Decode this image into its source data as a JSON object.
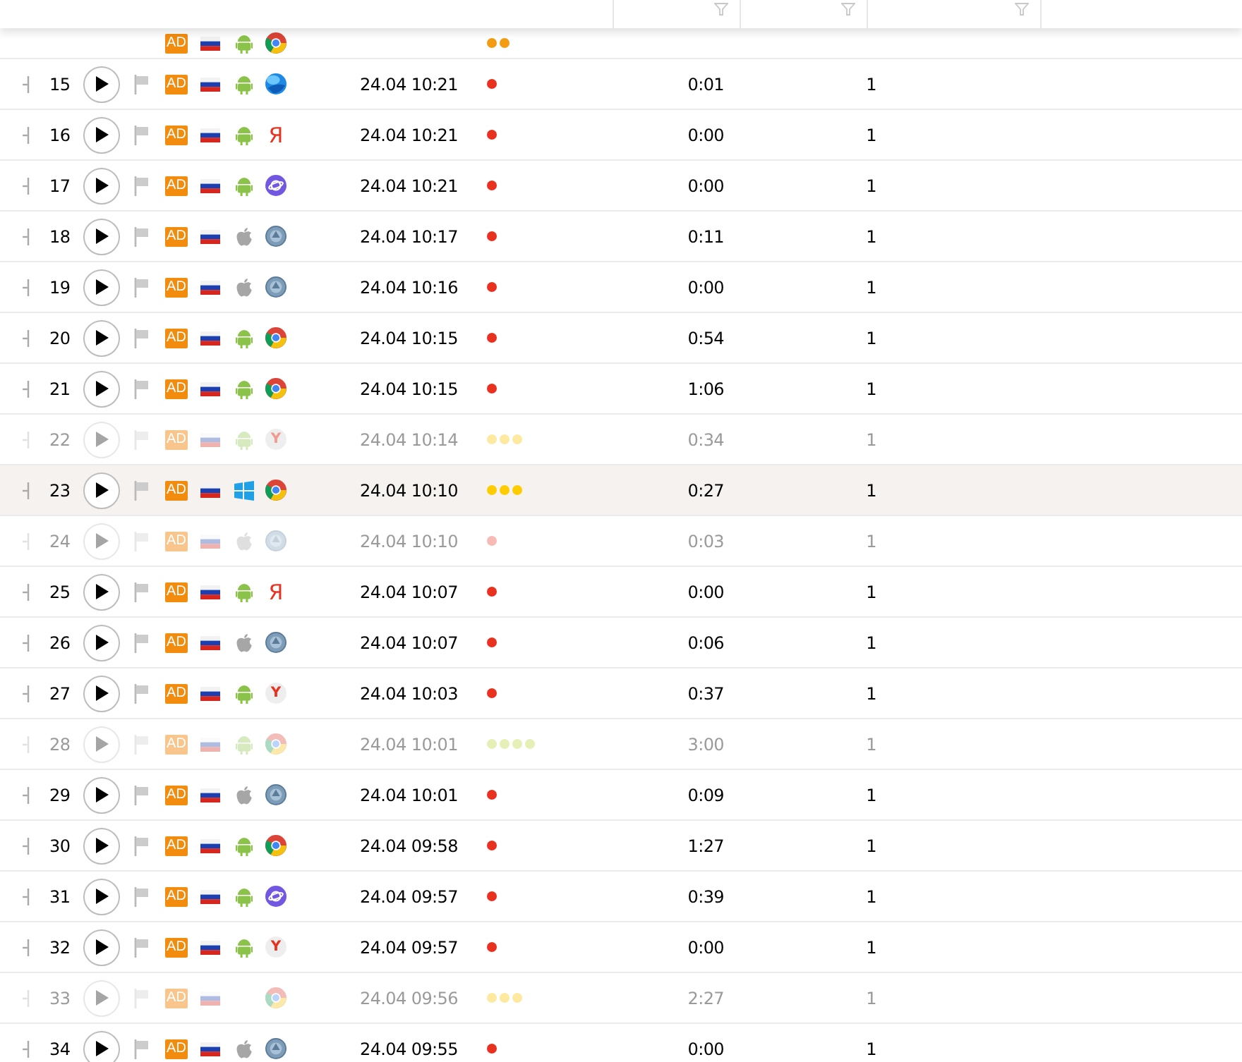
{
  "rows": [
    {
      "kind": "partial",
      "badge": "AD",
      "os": {
        "kind": "android"
      },
      "browser": {
        "kind": "chrome"
      },
      "dots": [
        {
          "color": "#f39c12"
        },
        {
          "color": "#f39c12"
        }
      ],
      "faded": false,
      "selected": false
    },
    {
      "kind": "full",
      "number": "15",
      "badge": "AD",
      "os": {
        "kind": "android"
      },
      "browser": {
        "kind": "sphere"
      },
      "time": "24.04 10:21",
      "dots": [
        {
          "color": "#e8321f"
        }
      ],
      "duration": "0:01",
      "count": "1",
      "faded": false,
      "selected": false
    },
    {
      "kind": "full",
      "number": "16",
      "badge": "AD",
      "os": {
        "kind": "android"
      },
      "browser": {
        "kind": "letter",
        "text": "Я"
      },
      "time": "24.04 10:21",
      "dots": [
        {
          "color": "#e8321f"
        }
      ],
      "duration": "0:00",
      "count": "1",
      "faded": false,
      "selected": false
    },
    {
      "kind": "full",
      "number": "17",
      "badge": "AD",
      "os": {
        "kind": "android"
      },
      "browser": {
        "kind": "purple"
      },
      "time": "24.04 10:21",
      "dots": [
        {
          "color": "#e8321f"
        }
      ],
      "duration": "0:00",
      "count": "1",
      "faded": false,
      "selected": false
    },
    {
      "kind": "full",
      "number": "18",
      "badge": "AD",
      "os": {
        "kind": "apple"
      },
      "browser": {
        "kind": "globe"
      },
      "time": "24.04 10:17",
      "dots": [
        {
          "color": "#e8321f"
        }
      ],
      "duration": "0:11",
      "count": "1",
      "faded": false,
      "selected": false
    },
    {
      "kind": "full",
      "number": "19",
      "badge": "AD",
      "os": {
        "kind": "apple"
      },
      "browser": {
        "kind": "globe"
      },
      "time": "24.04 10:16",
      "dots": [
        {
          "color": "#e8321f"
        }
      ],
      "duration": "0:00",
      "count": "1",
      "faded": false,
      "selected": false
    },
    {
      "kind": "full",
      "number": "20",
      "badge": "AD",
      "os": {
        "kind": "android"
      },
      "browser": {
        "kind": "chrome"
      },
      "time": "24.04 10:15",
      "dots": [
        {
          "color": "#e8321f"
        }
      ],
      "duration": "0:54",
      "count": "1",
      "faded": false,
      "selected": false
    },
    {
      "kind": "full",
      "number": "21",
      "badge": "AD",
      "os": {
        "kind": "android"
      },
      "browser": {
        "kind": "chrome"
      },
      "time": "24.04 10:15",
      "dots": [
        {
          "color": "#e8321f"
        }
      ],
      "duration": "1:06",
      "count": "1",
      "faded": false,
      "selected": false
    },
    {
      "kind": "full",
      "number": "22",
      "badge": "AD",
      "os": {
        "kind": "android"
      },
      "browser": {
        "kind": "circle-letter",
        "text": "Y"
      },
      "time": "24.04 10:14",
      "dots": [
        {
          "color": "#fde9a0"
        },
        {
          "color": "#fde9a0"
        },
        {
          "color": "#fde9a0"
        }
      ],
      "duration": "0:34",
      "count": "1",
      "faded": true,
      "selected": false
    },
    {
      "kind": "full",
      "number": "23",
      "badge": "AD",
      "os": {
        "kind": "windows"
      },
      "browser": {
        "kind": "chrome"
      },
      "time": "24.04 10:10",
      "dots": [
        {
          "color": "#ffcc00"
        },
        {
          "color": "#ffcc00"
        },
        {
          "color": "#ffcc00"
        }
      ],
      "duration": "0:27",
      "count": "1",
      "faded": false,
      "selected": true
    },
    {
      "kind": "full",
      "number": "24",
      "badge": "AD",
      "os": {
        "kind": "apple"
      },
      "browser": {
        "kind": "globe"
      },
      "time": "24.04 10:10",
      "dots": [
        {
          "color": "#f7bab4"
        }
      ],
      "duration": "0:03",
      "count": "1",
      "faded": true,
      "selected": false
    },
    {
      "kind": "full",
      "number": "25",
      "badge": "AD",
      "os": {
        "kind": "android"
      },
      "browser": {
        "kind": "letter",
        "text": "Я"
      },
      "time": "24.04 10:07",
      "dots": [
        {
          "color": "#e8321f"
        }
      ],
      "duration": "0:00",
      "count": "1",
      "faded": false,
      "selected": false
    },
    {
      "kind": "full",
      "number": "26",
      "badge": "AD",
      "os": {
        "kind": "apple"
      },
      "browser": {
        "kind": "globe"
      },
      "time": "24.04 10:07",
      "dots": [
        {
          "color": "#e8321f"
        }
      ],
      "duration": "0:06",
      "count": "1",
      "faded": false,
      "selected": false
    },
    {
      "kind": "full",
      "number": "27",
      "badge": "AD",
      "os": {
        "kind": "android"
      },
      "browser": {
        "kind": "circle-letter",
        "text": "Y"
      },
      "time": "24.04 10:03",
      "dots": [
        {
          "color": "#e8321f"
        }
      ],
      "duration": "0:37",
      "count": "1",
      "faded": false,
      "selected": false
    },
    {
      "kind": "full",
      "number": "28",
      "badge": "AD",
      "os": {
        "kind": "android"
      },
      "browser": {
        "kind": "chrome"
      },
      "time": "24.04 10:01",
      "dots": [
        {
          "color": "#e6efb5"
        },
        {
          "color": "#e6efb5"
        },
        {
          "color": "#e6efb5"
        },
        {
          "color": "#e6efb5"
        }
      ],
      "duration": "3:00",
      "count": "1",
      "faded": true,
      "selected": false
    },
    {
      "kind": "full",
      "number": "29",
      "badge": "AD",
      "os": {
        "kind": "apple"
      },
      "browser": {
        "kind": "globe"
      },
      "time": "24.04 10:01",
      "dots": [
        {
          "color": "#e8321f"
        }
      ],
      "duration": "0:09",
      "count": "1",
      "faded": false,
      "selected": false
    },
    {
      "kind": "full",
      "number": "30",
      "badge": "AD",
      "os": {
        "kind": "android"
      },
      "browser": {
        "kind": "chrome"
      },
      "time": "24.04 09:58",
      "dots": [
        {
          "color": "#e8321f"
        }
      ],
      "duration": "1:27",
      "count": "1",
      "faded": false,
      "selected": false
    },
    {
      "kind": "full",
      "number": "31",
      "badge": "AD",
      "os": {
        "kind": "android"
      },
      "browser": {
        "kind": "purple"
      },
      "time": "24.04 09:57",
      "dots": [
        {
          "color": "#e8321f"
        }
      ],
      "duration": "0:39",
      "count": "1",
      "faded": false,
      "selected": false
    },
    {
      "kind": "full",
      "number": "32",
      "badge": "AD",
      "os": {
        "kind": "android"
      },
      "browser": {
        "kind": "circle-letter",
        "text": "Y"
      },
      "time": "24.04 09:57",
      "dots": [
        {
          "color": "#e8321f"
        }
      ],
      "duration": "0:00",
      "count": "1",
      "faded": false,
      "selected": false
    },
    {
      "kind": "full",
      "number": "33",
      "badge": "AD",
      "os": {
        "kind": "none"
      },
      "browser": {
        "kind": "chrome"
      },
      "time": "24.04 09:56",
      "dots": [
        {
          "color": "#fde9a0"
        },
        {
          "color": "#fde9a0"
        },
        {
          "color": "#fde9a0"
        }
      ],
      "duration": "2:27",
      "count": "1",
      "faded": true,
      "selected": false
    },
    {
      "kind": "full",
      "number": "34",
      "badge": "AD",
      "os": {
        "kind": "apple"
      },
      "browser": {
        "kind": "globe"
      },
      "time": "24.04 09:55",
      "dots": [
        {
          "color": "#e8321f"
        }
      ],
      "duration": "0:00",
      "count": "1",
      "faded": false,
      "selected": false
    }
  ]
}
